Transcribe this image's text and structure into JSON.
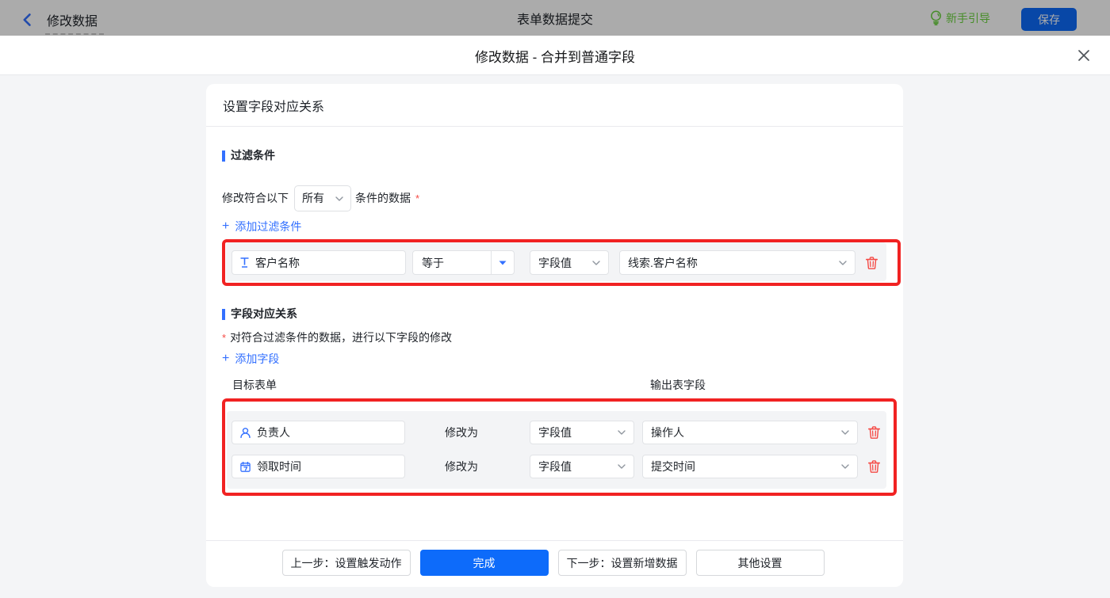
{
  "topbar": {
    "back_icon": "chevron-left",
    "flow_title": "修改数据",
    "center_title": "表单数据提交",
    "guide_label": "新手引导",
    "guide_icon": "lightbulb",
    "save_label": "保存"
  },
  "modal": {
    "title": "修改数据 - 合并到普通字段",
    "close_icon": "close"
  },
  "card": {
    "title": "设置字段对应关系"
  },
  "filter_section": {
    "header": "过滤条件",
    "condition_prefix": "修改符合以下",
    "match_select_value": "所有",
    "condition_suffix": "条件的数据",
    "required_mark": "*",
    "add_link": "添加过滤条件",
    "plus": "+",
    "row": {
      "field_icon": "text-field",
      "field_value": "客户名称",
      "operator_value": "等于",
      "value_type": "字段值",
      "value_field": "线索.客户名称",
      "delete_icon": "trash"
    }
  },
  "mapping_section": {
    "header": "字段对应关系",
    "required_mark": "*",
    "description": "对符合过滤条件的数据，进行以下字段的修改",
    "add_link": "添加字段",
    "plus": "+",
    "col_target": "目标表单",
    "col_output": "输出表字段",
    "rows": [
      {
        "field_icon": "user",
        "field_value": "负责人",
        "action": "修改为",
        "value_type": "字段值",
        "value_field": "操作人",
        "delete_icon": "trash"
      },
      {
        "field_icon": "calendar",
        "field_value": "领取时间",
        "action": "修改为",
        "value_type": "字段值",
        "value_field": "提交时间",
        "delete_icon": "trash"
      }
    ]
  },
  "footer": {
    "prev_label": "上一步：设置触发动作",
    "done_label": "完成",
    "next_label": "下一步：设置新增数据",
    "other_label": "其他设置"
  },
  "colors": {
    "primary_blue": "#0d6bfa",
    "link_blue": "#3370ff",
    "danger_red": "#e63232",
    "trash_red": "#f54a45",
    "guide_green": "#6bd23f"
  }
}
